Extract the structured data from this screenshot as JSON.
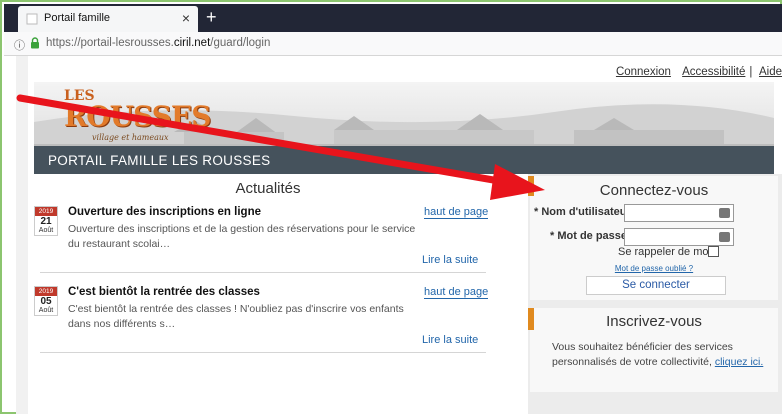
{
  "browser": {
    "tab_title": "Portail famille",
    "tab_close": "×",
    "new_tab": "+",
    "info_icon": "ⓘ",
    "url_pre": "https://portail-lesrousses.",
    "url_domain": "ciril.net",
    "url_post": "/guard/login"
  },
  "header": {
    "links": [
      "Connexion",
      "Accessibilité",
      "Aide"
    ],
    "logo_les": "LES",
    "logo_rousses": "ROUSSES",
    "logo_tagline": "village et hameaux",
    "site_title": "PORTAIL FAMILLE LES ROUSSES"
  },
  "news": {
    "title": "Actualités",
    "items": [
      {
        "year": "2019",
        "day": "21",
        "month": "Août",
        "headline": "Ouverture des inscriptions en ligne",
        "top_link": "haut de page",
        "text": "Ouverture des inscriptions et de la gestion des réservations pour le service du restaurant scolai…",
        "more": "Lire la suite"
      },
      {
        "year": "2019",
        "day": "05",
        "month": "Août",
        "headline": "C'est bientôt la rentrée des classes",
        "top_link": "haut de page",
        "text": "C'est bientôt la rentrée des classes ! N'oubliez pas d'inscrire vos enfants dans nos différents s…",
        "more": "Lire la suite"
      }
    ]
  },
  "login": {
    "title": "Connectez-vous",
    "username_label": "* Nom d'utilisateur",
    "password_label": "* Mot de passe :",
    "remember_label": "Se rappeler de moi",
    "forgot_link": "Mot de passe oublié ?",
    "submit": "Se connecter"
  },
  "register": {
    "title": "Inscrivez-vous",
    "text": "Vous souhaitez bénéficier des services personnalisés de votre collectivité,",
    "link": "cliquez ici."
  },
  "colors": {
    "accent": "#e08a1f",
    "title_bar": "#45525c",
    "link": "#2266aa",
    "annotation_arrow": "#e8141c"
  }
}
